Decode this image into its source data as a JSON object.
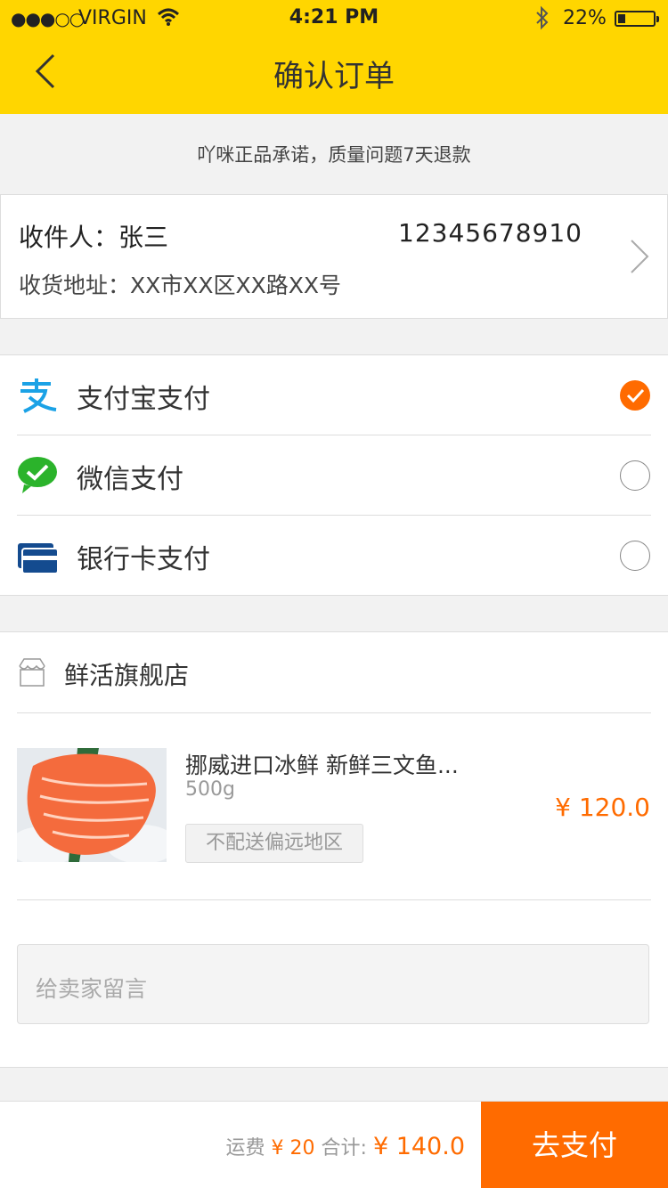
{
  "status_bar": {
    "signal": "●●●○○",
    "carrier": "VIRGIN",
    "time": "4:21 PM",
    "battery_percent": "22%",
    "battery_level": 0.22
  },
  "nav": {
    "title": "确认订单"
  },
  "promise": "吖咪正品承诺，质量问题7天退款",
  "address": {
    "recipient": "收件人：张三",
    "phone": "12345678910",
    "address": "收货地址：XX市XX区XX路XX号"
  },
  "payment": {
    "options": [
      {
        "label": "支付宝支付",
        "icon": "alipay-icon",
        "selected": true
      },
      {
        "label": "微信支付",
        "icon": "wechat-pay-icon",
        "selected": false
      },
      {
        "label": "银行卡支付",
        "icon": "bank-card-icon",
        "selected": false
      }
    ]
  },
  "order": {
    "shop_name": "鲜活旗舰店",
    "product": {
      "name": "挪威进口冰鲜 新鲜三文鱼...",
      "weight": "500g",
      "tag": "不配送偏远地区",
      "price": "¥ 120.0"
    },
    "message_placeholder": "给卖家留言"
  },
  "footer": {
    "shipping_label": "运费",
    "shipping_value": "¥ 20",
    "total_label": "合计:",
    "total_value": "¥ 140.0",
    "pay_button": "去支付"
  },
  "colors": {
    "header": "#ffd600",
    "accent": "#ff6b00",
    "alipay": "#1ba2e6",
    "wechat": "#2bb32b",
    "bank": "#144b8f"
  }
}
